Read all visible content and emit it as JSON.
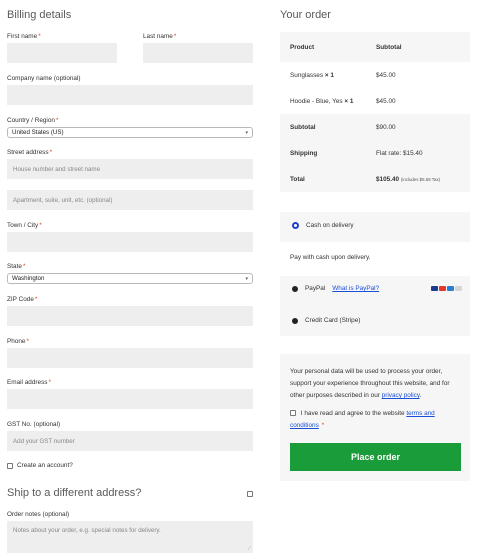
{
  "billing": {
    "heading": "Billing details",
    "first_name_label": "First name",
    "last_name_label": "Last name",
    "company_label": "Company name (optional)",
    "country_label": "Country / Region",
    "country_value": "United States (US)",
    "street_label": "Street address",
    "street_placeholder": "House number and street name",
    "street2_placeholder": "Apartment, suite, unit, etc. (optional)",
    "town_label": "Town / City",
    "state_label": "State",
    "state_value": "Washington",
    "zip_label": "ZIP Code",
    "phone_label": "Phone",
    "email_label": "Email address",
    "gst_label": "GST No. (optional)",
    "gst_placeholder": "Add your GST number",
    "create_account_label": "Create an account?",
    "required_mark": "*"
  },
  "shipping": {
    "heading": "Ship to a different address?",
    "notes_label": "Order notes (optional)",
    "notes_placeholder": "Notes about your order, e.g. special notes for delivery."
  },
  "order": {
    "heading": "Your order",
    "col_product": "Product",
    "col_subtotal": "Subtotal",
    "items": [
      {
        "name": "Sunglasses",
        "qty": "× 1",
        "subtotal": "$45.00"
      },
      {
        "name": "Hoodie - Blue, Yes",
        "qty": "× 1",
        "subtotal": "$45.00"
      }
    ],
    "subtotal_label": "Subtotal",
    "subtotal_value": "$90.00",
    "shipping_label": "Shipping",
    "shipping_value": "Flat rate: $15.40",
    "total_label": "Total",
    "total_value": "$105.40",
    "total_note": "(includes $5.58 Tax)"
  },
  "payment": {
    "cod_label": "Cash on delivery",
    "cod_description": "Pay with cash upon delivery.",
    "paypal_label": "PayPal",
    "paypal_link": "What is PayPal?",
    "card_label": "Credit Card (Stripe)"
  },
  "privacy": {
    "text": "Your personal data will be used to process your order, support your experience throughout this website, and for other purposes described in our",
    "link": "privacy policy",
    "terms_prefix": "I have read and agree to the website",
    "terms_link": "terms and conditions"
  },
  "place_order_label": "Place order"
}
